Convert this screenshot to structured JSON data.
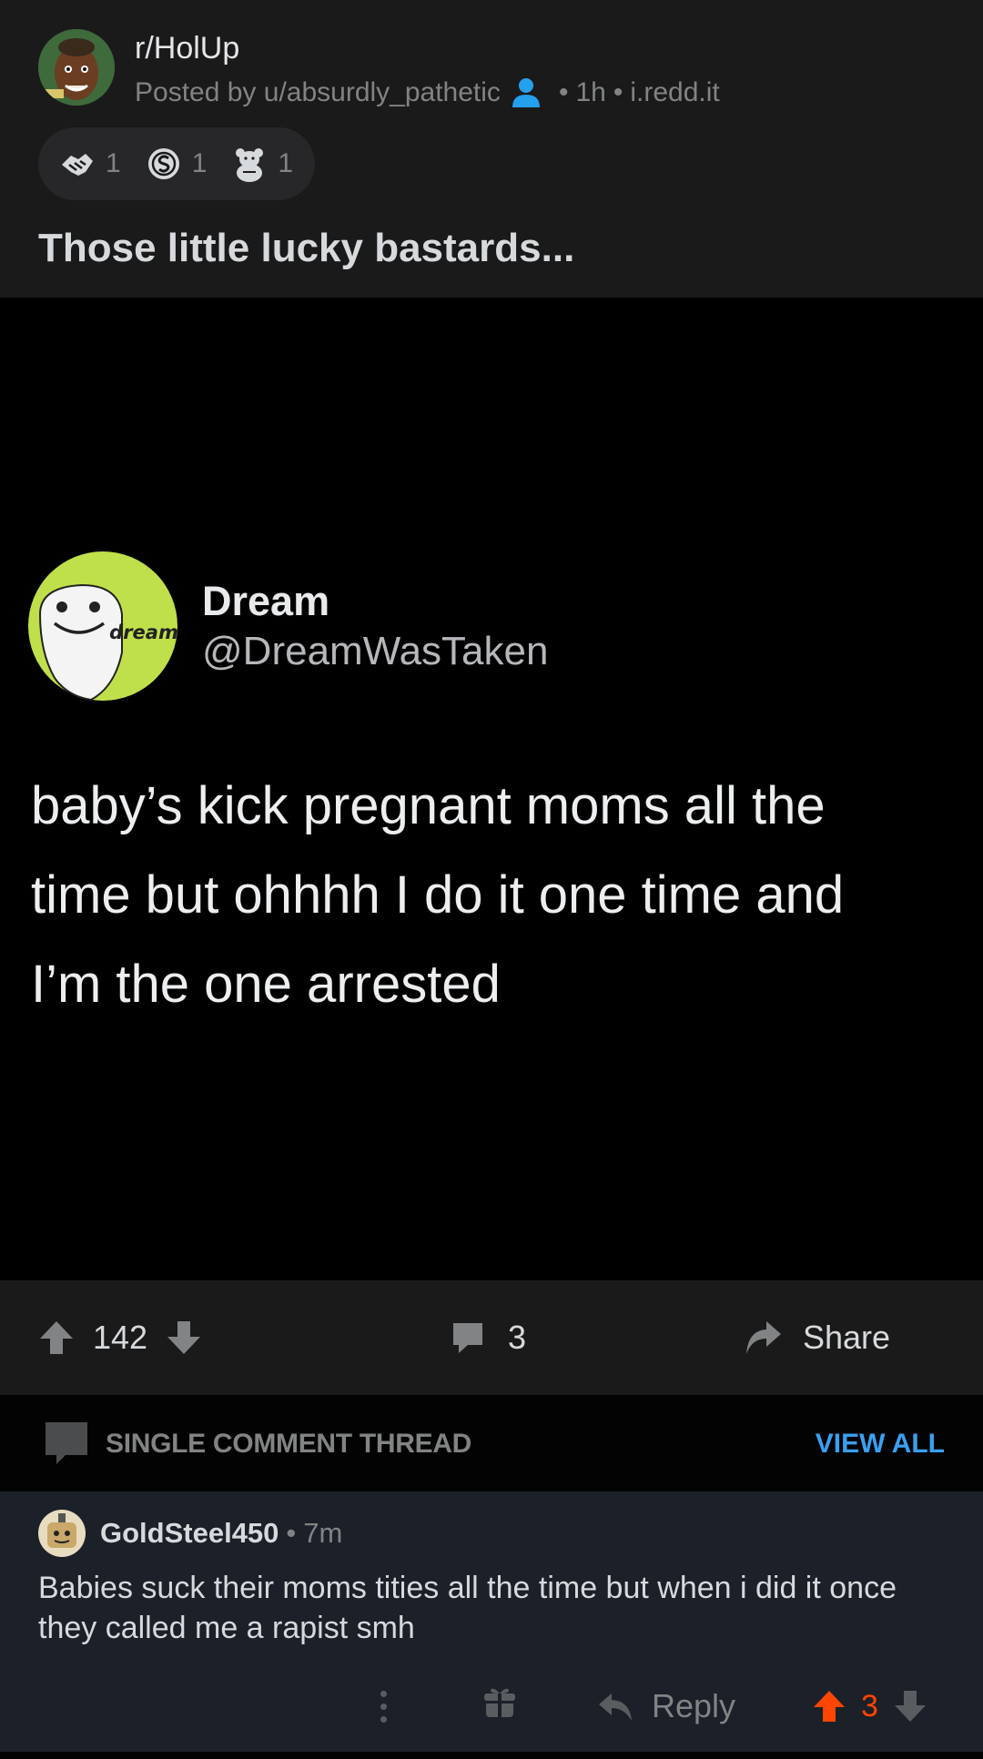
{
  "post": {
    "subreddit": "r/HolUp",
    "posted_by": "Posted by u/absurdly_pathetic",
    "age": "1h",
    "domain": "i.redd.it",
    "awards": [
      {
        "icon": "handshake-award-icon",
        "count": "1"
      },
      {
        "icon": "silver-coin-award-icon",
        "count": "1"
      },
      {
        "icon": "bear-award-icon",
        "count": "1"
      }
    ],
    "title": "Those little lucky bastards..."
  },
  "tweet": {
    "name": "Dream",
    "handle": "@DreamWasTaken",
    "avatar_text": "dream",
    "lines": [
      "baby’s kick pregnant moms all the",
      "time but ohhhh I do it one time and",
      "I’m the one arrested"
    ]
  },
  "actions": {
    "score": "142",
    "comments": "3",
    "share_label": "Share"
  },
  "thread": {
    "label": "SINGLE COMMENT THREAD",
    "view_all": "VIEW ALL"
  },
  "comment": {
    "author": "GoldSteel450",
    "separator": "•",
    "age": "7m",
    "body": "Babies suck their moms tities all the time but when i did it once they called me a rapist smh",
    "reply_label": "Reply",
    "score": "3"
  },
  "colors": {
    "accent_blue": "#3aa0f0",
    "upvote_orange": "#ff4500",
    "dream_green": "#bfe04a"
  }
}
